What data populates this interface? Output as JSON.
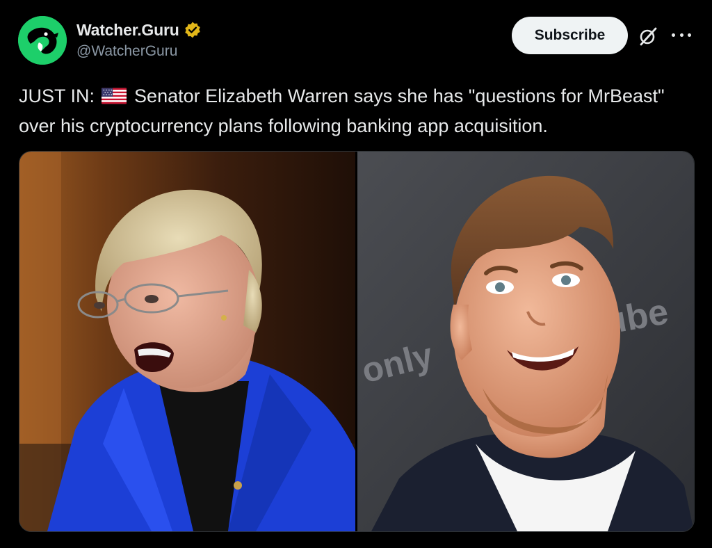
{
  "author": {
    "display_name": "Watcher.Guru",
    "handle": "@WatcherGuru",
    "avatar_icon": "whale-logo-icon",
    "verified_icon": "verified-badge-icon",
    "avatar_color": "#1dcf6a",
    "verified_color": "#e2b719"
  },
  "actions": {
    "subscribe_label": "Subscribe",
    "grok_icon": "grok-icon",
    "more_icon": "more-options-icon"
  },
  "tweet": {
    "prefix": "JUST IN:",
    "flag_icon": "us-flag-icon",
    "body": "Senator Elizabeth Warren says she has \"questions for MrBeast\" over his cryptocurrency plans following banking app acquisition."
  },
  "media": {
    "photos": [
      "photo-elizabeth-warren",
      "photo-mrbeast"
    ],
    "backdrop_text": "only",
    "backdrop_text_2": "ube"
  }
}
